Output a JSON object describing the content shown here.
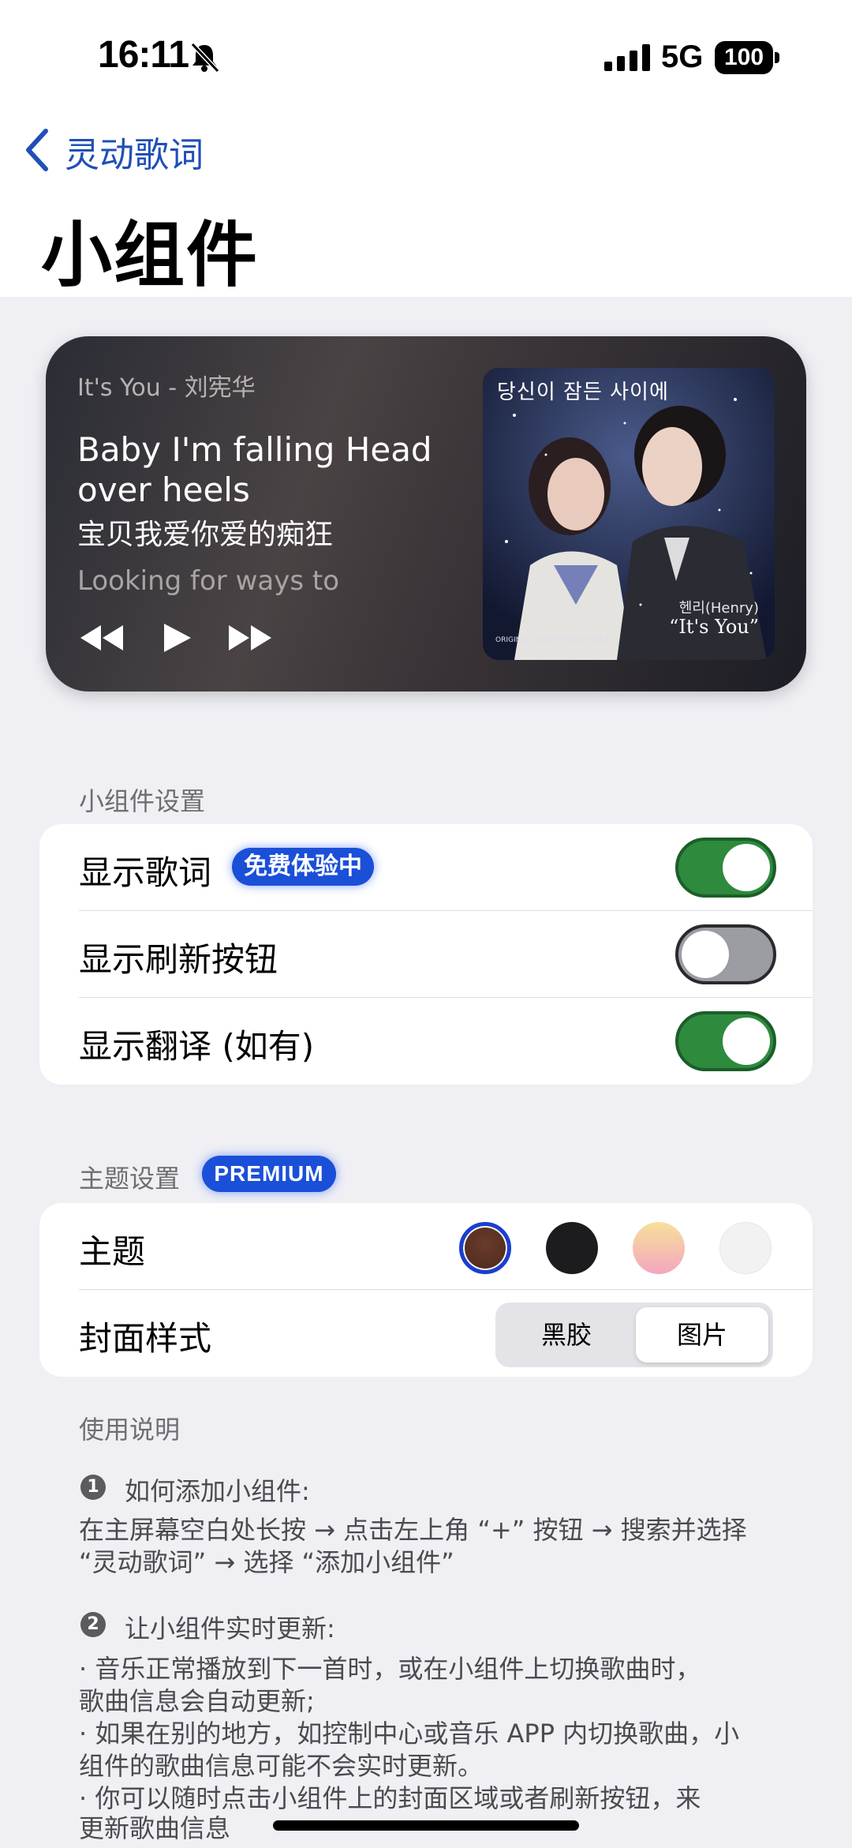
{
  "status_bar": {
    "time": "16:11",
    "network": "5G",
    "battery": "100"
  },
  "nav": {
    "back_label": "灵动歌词",
    "title": "小组件"
  },
  "widget": {
    "song": "It's You - 刘宪华",
    "lyric": "Baby I'm falling Head over heels",
    "translation": "宝贝我爱你爱的痴狂",
    "next_line": "Looking for ways to",
    "cover": {
      "art_title": "당신이 잠든 사이에",
      "footer": "ORIGINAL SOUND TRACK PART.2",
      "artist": "헨리(Henry)",
      "song": "“It's You”"
    }
  },
  "widget_settings": {
    "section_label": "小组件设置",
    "rows": [
      {
        "label": "显示歌词",
        "badge": "免费体验中",
        "enabled": true
      },
      {
        "label": "显示刷新按钮",
        "enabled": false
      },
      {
        "label": "显示翻译 (如有)",
        "enabled": true
      }
    ]
  },
  "theme_settings": {
    "section_label": "主题设置",
    "badge": "PREMIUM",
    "theme_label": "主题",
    "swatches": [
      "#5a3020",
      "#1c1c1e",
      "#f6c9b0",
      "#f2f2f3"
    ],
    "selected_swatch": 0,
    "cover_style_label": "封面样式",
    "cover_style_options": [
      "黑胶",
      "图片"
    ],
    "cover_style_selected": "图片"
  },
  "instructions": {
    "title": "使用说明",
    "step1_num": "1",
    "step1_title": "如何添加小组件:",
    "step1_line1": "在主屏幕空白处长按 → 点击左上角 “+” 按钮 → 搜索并选择",
    "step1_line2": "“灵动歌词” → 选择 “添加小组件”",
    "step2_num": "2",
    "step2_title": "让小组件实时更新:",
    "step2_line1": "· 音乐正常播放到下一首时，或在小组件上切换歌曲时，",
    "step2_line2": "歌曲信息会自动更新;",
    "step2_line3": "· 如果在别的地方，如控制中心或音乐 APP 内切换歌曲，小",
    "step2_line4": "组件的歌曲信息可能不会实时更新。",
    "step2_line5": "· 你可以随时点击小组件上的封面区域或者刷新按钮，来",
    "step2_line6": "更新歌曲信息"
  }
}
